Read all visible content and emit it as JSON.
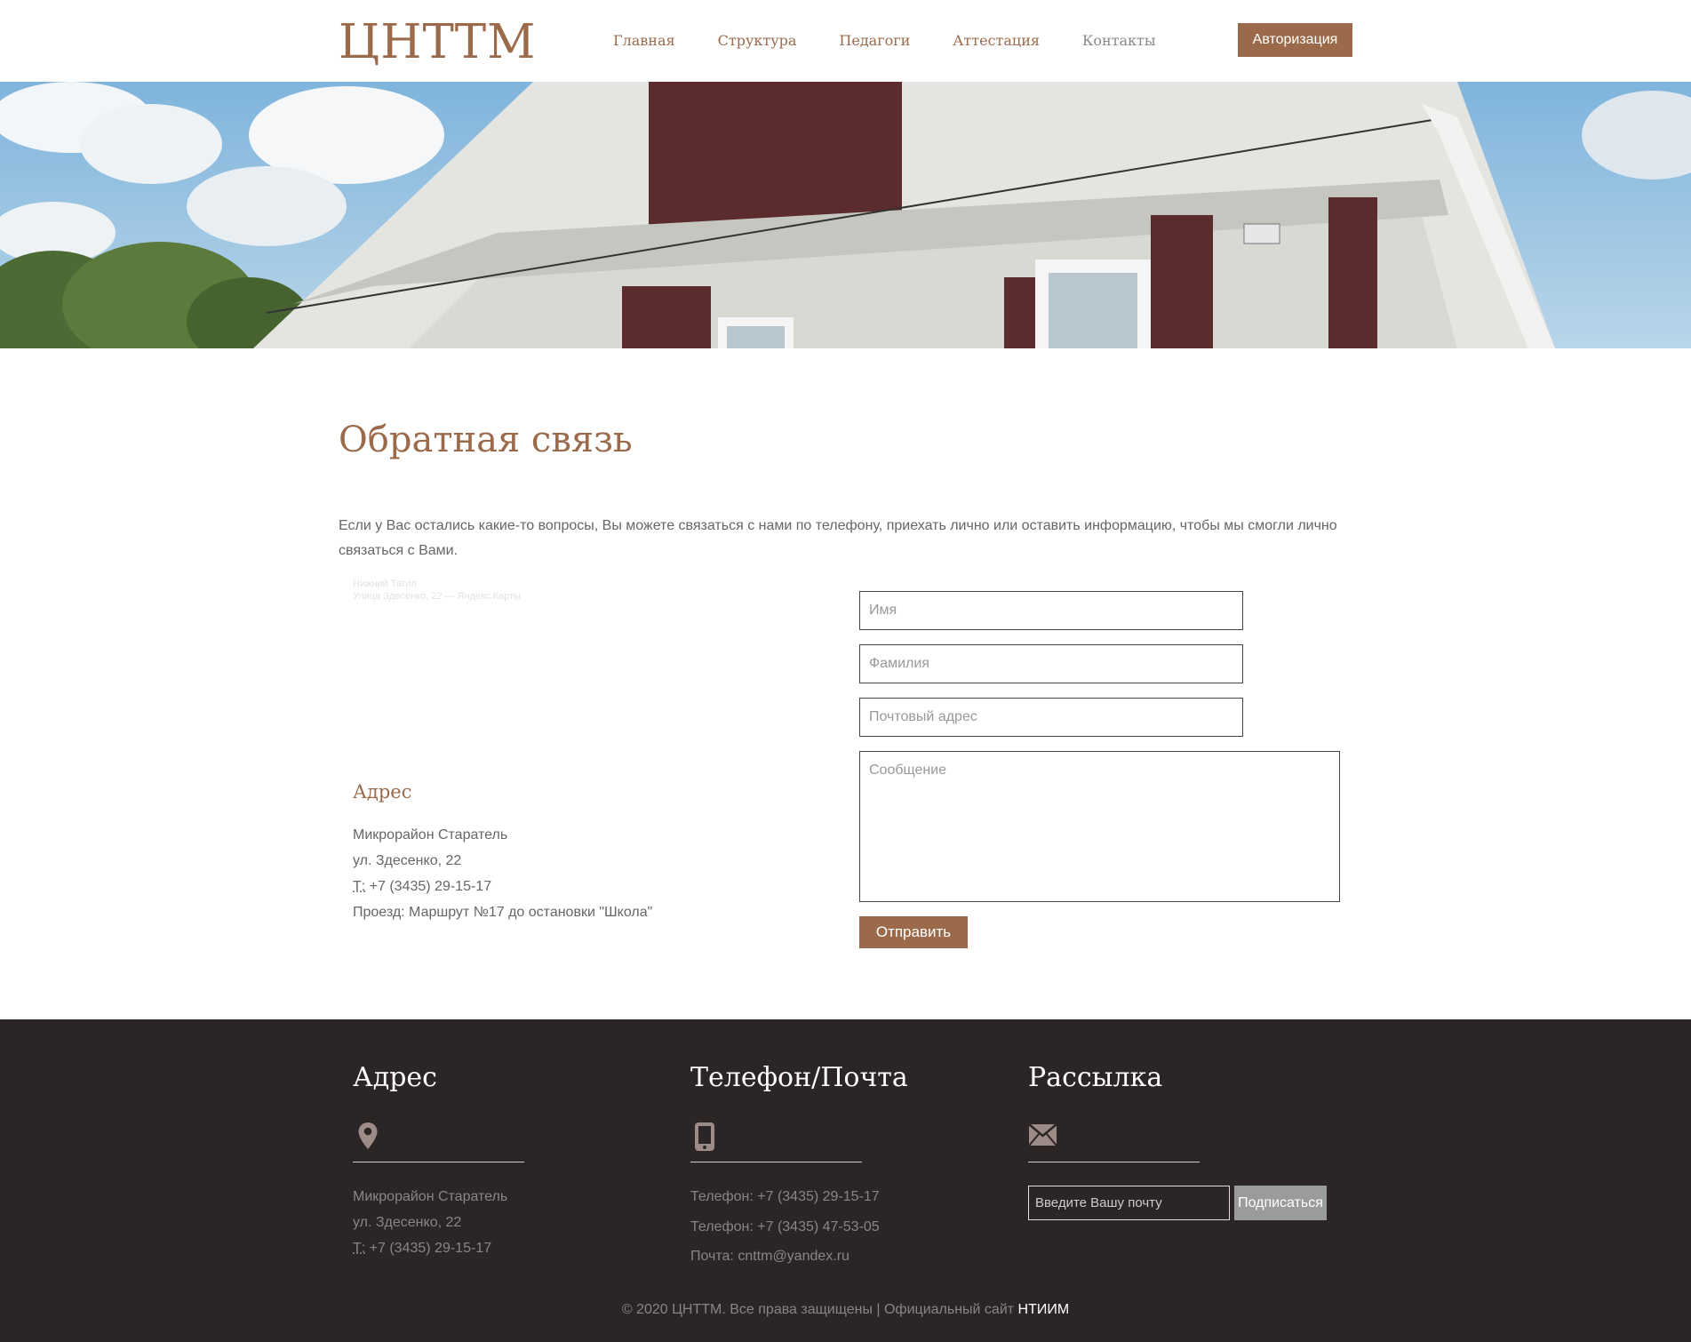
{
  "header": {
    "logo": "ЦНТТМ",
    "nav": [
      "Главная",
      "Структура",
      "Педагоги",
      "Аттестация",
      "Контакты"
    ],
    "auth_label": "Авторизация"
  },
  "main": {
    "title": "Обратная связь",
    "intro": "Если у Вас остались какие-то вопросы, Вы можете связаться с нами по телефону, приехать лично или оставить информацию, чтобы мы смогли лично связаться с Вами.",
    "map_caption": {
      "city": "Нижний Тагил",
      "link": "Улица Здесенко, 22 — Яндекс.Карты"
    },
    "address": {
      "heading": "Адрес",
      "line1": "Микрорайон Старатель",
      "line2": "ул. Здесенко, 22",
      "phone_abbr": "Т:",
      "phone": " +7 (3435) 29-15-17",
      "route": "Проезд: Маршрут №17 до остановки \"Школа\""
    },
    "form": {
      "name_placeholder": "Имя",
      "surname_placeholder": "Фамилия",
      "email_placeholder": "Почтовый адрес",
      "message_placeholder": "Сообщение",
      "send_label": "Отправить"
    }
  },
  "footer": {
    "address": {
      "title": "Адрес",
      "icon": "map-pin-icon",
      "line1": "Микрорайон Старатель",
      "line2": "ул. Здесенко, 22",
      "phone_abbr": "Т:",
      "phone": " +7 (3435) 29-15-17"
    },
    "contacts": {
      "title": "Телефон/Почта",
      "icon": "phone-icon",
      "phone1": "Телефон: +7 (3435) 29-15-17",
      "phone2": "Телефон: +7 (3435) 47-53-05",
      "email": "Почта: cnttm@yandex.ru"
    },
    "newsletter": {
      "title": "Рассылка",
      "icon": "envelope-icon",
      "placeholder": "Введите Вашу почту",
      "button": "Подписаться"
    },
    "copyright": "© 2020 ЦНТТМ. Все права защищены | Официальный сайт ",
    "copyright_link": "НТИИМ"
  },
  "colors": {
    "accent": "#9a6a4b",
    "footer_bg": "#2b2525",
    "subscribe_button": "#999b9d"
  }
}
